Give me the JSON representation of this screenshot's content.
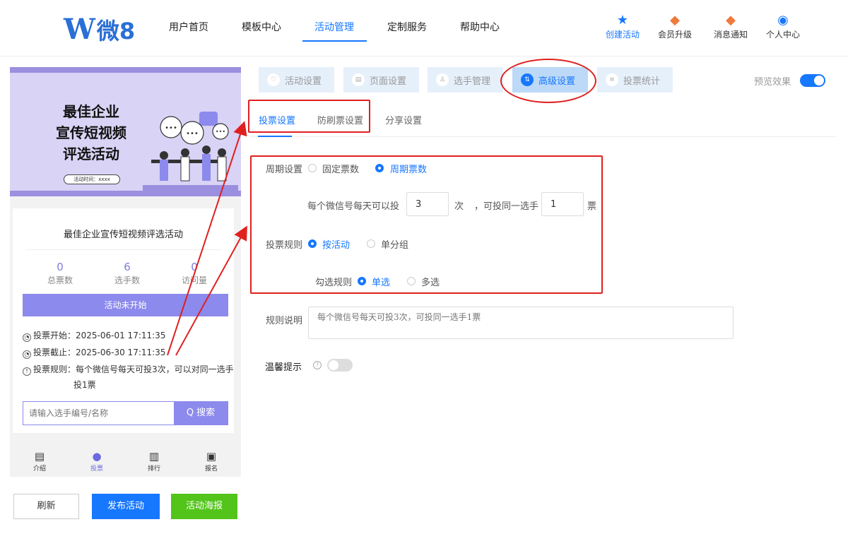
{
  "header": {
    "logo_w": "W",
    "logo_text": "微8",
    "nav": [
      "用户首页",
      "模板中心",
      "活动管理",
      "定制服务",
      "帮助中心"
    ],
    "active_nav": "活动管理",
    "actions": [
      {
        "label": "创建活动",
        "icon": "star-icon"
      },
      {
        "label": "会员升级",
        "icon": "crown-badge-icon"
      },
      {
        "label": "消息通知",
        "icon": "bell-badge-icon"
      },
      {
        "label": "个人中心",
        "icon": "user-circle-icon"
      }
    ],
    "accent": "#1677ff"
  },
  "preview": {
    "banner_title_lines": [
      "最佳企业",
      "宣传短视频",
      "评选活动"
    ],
    "banner_time": "活动时间：xxxx",
    "activity_title": "最佳企业宣传短视频评选活动",
    "stats": [
      {
        "value": "0",
        "label": "总票数"
      },
      {
        "value": "6",
        "label": "选手数"
      },
      {
        "value": "0",
        "label": "访问量"
      }
    ],
    "status_button": "活动未开始",
    "vote_start": "投票开始：2025-06-01 17:11:35",
    "vote_end": "投票截止：2025-06-30 17:11:35",
    "vote_rule_line1": "投票规则：每个微信号每天可投3次，可以对同一选手",
    "vote_rule_line2": "投1票",
    "search_placeholder": "请输入选手编号/名称",
    "search_button": "Q 搜索",
    "tabbar": [
      {
        "label": "介绍",
        "icon": "doc-icon"
      },
      {
        "label": "投票",
        "icon": "user-icon"
      },
      {
        "label": "排行",
        "icon": "bar-chart-icon"
      },
      {
        "label": "报名",
        "icon": "signup-icon"
      }
    ],
    "active_tab": "投票",
    "theme_color": "#8c8aec"
  },
  "bottom_buttons": {
    "refresh": "刷新",
    "publish": "发布活动",
    "poster": "活动海报"
  },
  "settings_tabs": [
    "活动设置",
    "页面设置",
    "选手管理",
    "高级设置",
    "投票统计"
  ],
  "active_settings_tab": "高级设置",
  "preview_toggle_label": "预览效果",
  "preview_toggle_on": true,
  "sub_tabs": [
    "投票设置",
    "防刷票设置",
    "分享设置"
  ],
  "active_sub_tab": "投票设置",
  "form": {
    "cycle_label": "周期设置",
    "cycle_options": [
      "固定票数",
      "周期票数"
    ],
    "cycle_selected": "周期票数",
    "per_day_prefix": "每个微信号每天可以投",
    "per_day_value": "3",
    "per_day_unit": "次",
    "same_player_prefix": "，可投同一选手",
    "same_player_value": "1",
    "same_player_unit": "票",
    "vote_rule_label": "投票规则",
    "vote_rule_options": [
      "按活动",
      "单分组"
    ],
    "vote_rule_selected": "按活动",
    "check_rule_label": "勾选规则",
    "check_rule_options": [
      "单选",
      "多选"
    ],
    "check_rule_selected": "单选",
    "rule_desc_label": "规则说明",
    "rule_desc_placeholder": "每个微信号每天可投3次，可投同一选手1票",
    "tip_label": "温馨提示",
    "tip_help": "?",
    "tip_toggle_on": false
  },
  "annotation_color": "#e02020"
}
